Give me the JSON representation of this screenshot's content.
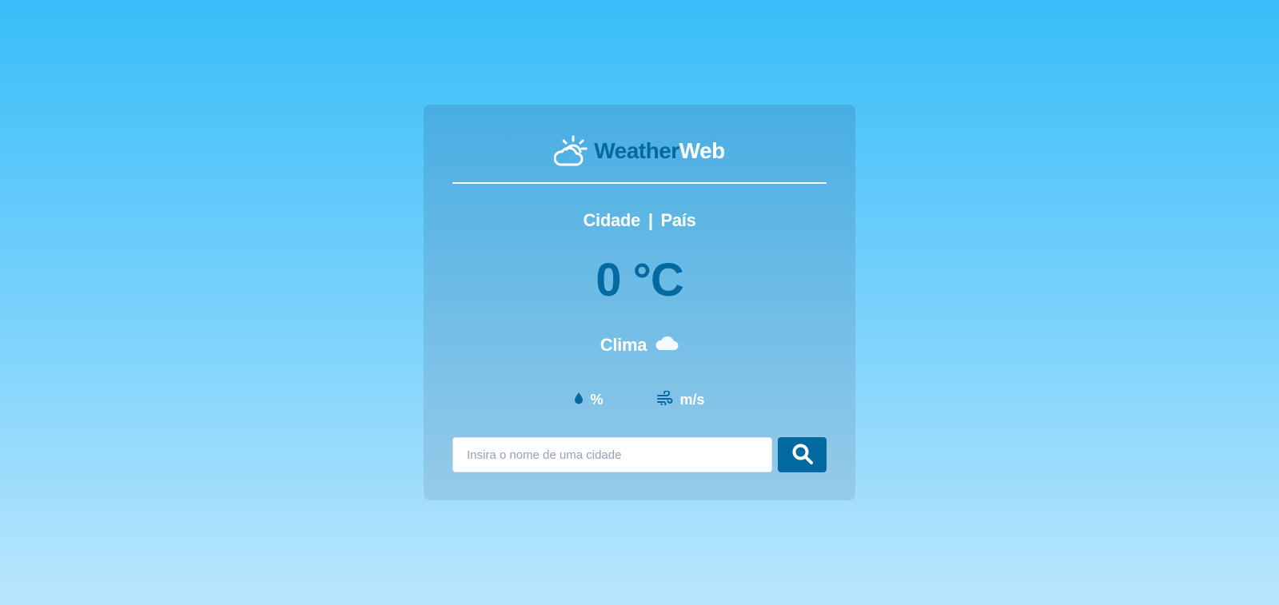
{
  "header": {
    "brand_part1": "Weather",
    "brand_part2": "Web",
    "logo_icon": "sun-behind-cloud-icon"
  },
  "weather": {
    "city": "Cidade",
    "separator": "|",
    "country": "País",
    "temperature": "0 °C",
    "condition": "Clima",
    "condition_icon": "cloud-icon",
    "humidity": "%",
    "humidity_icon": "droplet-icon",
    "wind": "m/s",
    "wind_icon": "wind-icon"
  },
  "search": {
    "placeholder": "Insira o nome de uma cidade",
    "value": "",
    "button_icon": "magnifying-glass-icon"
  },
  "colors": {
    "accent": "#0369a1",
    "text_light": "#ffffff",
    "background_top": "#38bdf8",
    "background_bottom": "#bae6fd"
  }
}
